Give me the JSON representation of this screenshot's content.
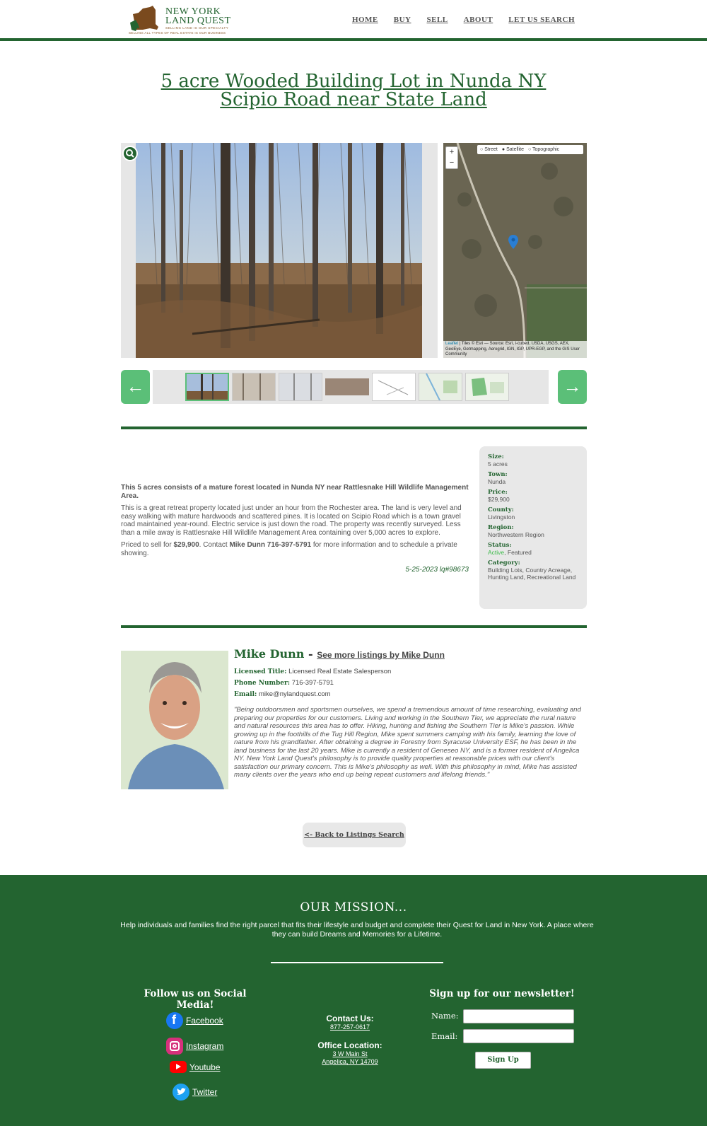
{
  "brand": {
    "line1": "NEW YORK",
    "line2": "LAND QUEST",
    "tagline1": "SELLING LAND IS OUR SPECIALTY",
    "tagline2": "SELLING ALL TYPES OF REAL ESTATE IS OUR BUSINESS",
    "accent": "#236430"
  },
  "nav": [
    "HOME",
    "BUY",
    "SELL",
    "ABOUT",
    "LET US SEARCH"
  ],
  "listing": {
    "title": "5 acre Wooded Building Lot in Nunda NY Scipio Road near State Land",
    "desc1": "This 5 acres consists of a mature forest located in Nunda NY near Rattlesnake Hill Wildlife Management Area.",
    "desc2": "This is a great retreat property located just under an hour from the Rochester area.  The land is very level and easy walking with mature hardwoods and scattered pines.  It is located on Scipio Road which is a town gravel road maintained year-round.  Electric service is just down the road.  The property was recently surveyed.  Less than a mile away is Rattlesnake Hill Wildlife Management Area containing over 5,000 acres to explore.",
    "desc3_a": "Priced to sell for ",
    "desc3_price": "$29,900",
    "desc3_b": ".  Contact ",
    "desc3_contact": "Mike Dunn 716-397-5791",
    "desc3_c": " for more information and to schedule a private showing.",
    "date_id": "5-25-2023 lq#98673"
  },
  "map": {
    "options": [
      "Street",
      "Satellite",
      "Topographic"
    ],
    "zoom_in": "+",
    "zoom_out": "−",
    "attribution_link": "Leaflet",
    "attribution": " | Tiles © Esri — Source: Esri, i-cubed, USDA, USGS, AEX, GeoEye, Getmapping, Aerogrid, IGN, IGP, UPR-EGP, and the GIS User Community"
  },
  "facts": [
    {
      "label": "Size:",
      "value": "5 acres"
    },
    {
      "label": "Town:",
      "value": "Nunda"
    },
    {
      "label": "Price:",
      "value": "$29,900"
    },
    {
      "label": "County:",
      "value": "Livingston"
    },
    {
      "label": "Region:",
      "value": "Northwestern Region"
    },
    {
      "label": "Status:",
      "value_active": "Active",
      "value": ", Featured"
    },
    {
      "label": "Category:",
      "value": "Building Lots, Country Acreage, Hunting Land, Recreational Land"
    }
  ],
  "agent": {
    "name": "Mike Dunn",
    "dash": " - ",
    "more_link": "See more listings by Mike Dunn",
    "title_label": "Licensed Title:",
    "title": "Licensed Real Estate Salesperson",
    "phone_label": "Phone Number:",
    "phone": "716-397-5791",
    "email_label": "Email:",
    "email": "mike@nylandquest.com",
    "bio": "\"Being outdoorsmen and sportsmen ourselves, we spend a tremendous amount of time researching, evaluating and preparing our properties for our customers. Living and working in the Southern Tier, we appreciate the rural nature and natural resources this area has to offer. Hiking, hunting and fishing the Southern Tier is Mike's passion. While growing up in the foothills of the Tug Hill Region, Mike spent summers camping with his family, learning the love of nature from his grandfather. After obtaining a degree in Forestry from Syracuse University ESF, he has been in the land business for the last 20 years. Mike is currently a resident of Geneseo NY, and is a former resident of Angelica NY. New York Land Quest's philosophy is to provide quality properties at reasonable prices with our client's satisfaction our primary concern. This is Mike's philosophy as well. With this philosophy in mind, Mike has assisted many clients over the years who end up being repeat customers and lifelong friends.\""
  },
  "back_label": "<- Back to Listings Search",
  "footer": {
    "mission_title": "OUR MISSION...",
    "mission_text": "Help individuals and families find the right parcel that fits their lifestyle and budget and complete their Quest for Land in New York. A place where they can build Dreams and Memories for a Lifetime.",
    "social_title": "Follow us on Social Media!",
    "social": [
      "Facebook",
      "Instagram",
      "Youtube",
      "Twitter"
    ],
    "contact_label": "Contact Us:",
    "phone": "877-257-0617",
    "office_label": "Office Location:",
    "address1": "3 W Main St",
    "address2": "Angelica, NY 14709",
    "news_title": "Sign up for our newsletter!",
    "name_label": "Name:",
    "email_label": "Email:",
    "signup": "Sign Up"
  }
}
